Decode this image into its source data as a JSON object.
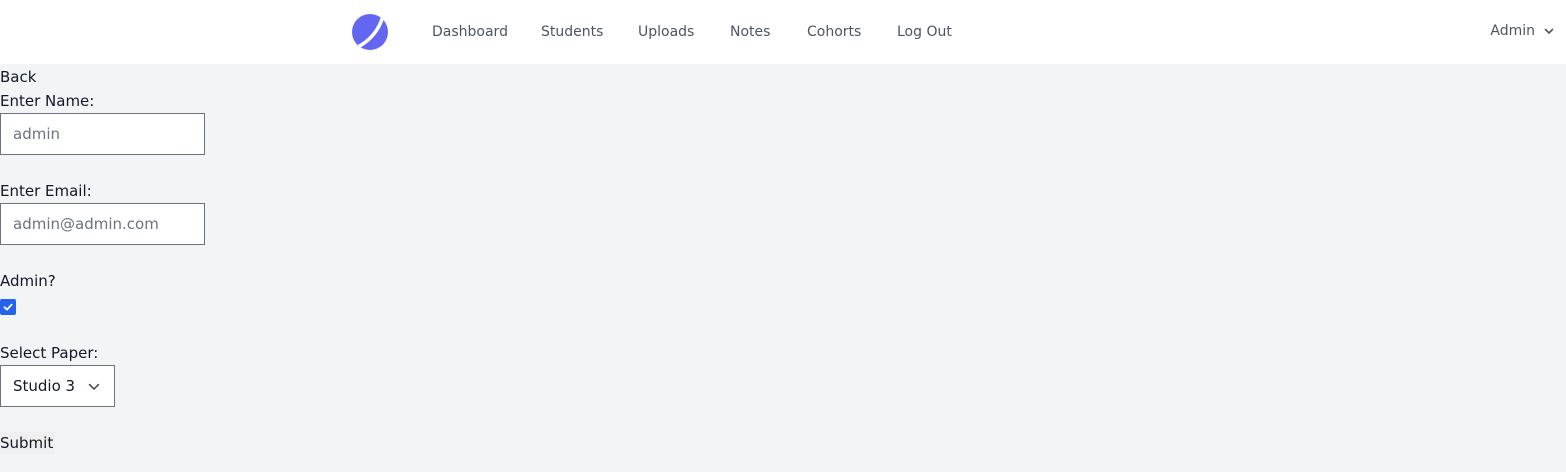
{
  "nav": {
    "links": [
      "Dashboard",
      "Students",
      "Uploads",
      "Notes",
      "Cohorts",
      "Log Out"
    ],
    "user": "Admin"
  },
  "form": {
    "back": "Back",
    "name_label": "Enter Name:",
    "name_placeholder": "admin",
    "email_label": "Enter Email:",
    "email_placeholder": "admin@admin.com",
    "admin_label": "Admin?",
    "admin_checked": true,
    "paper_label": "Select Paper:",
    "paper_selected": "Studio 3",
    "submit": "Submit"
  },
  "colors": {
    "accent": "#6366f1",
    "checkbox": "#2563eb",
    "background": "#f3f4f6"
  },
  "icons": [
    "logo-icon",
    "chevron-down-icon",
    "check-icon"
  ]
}
